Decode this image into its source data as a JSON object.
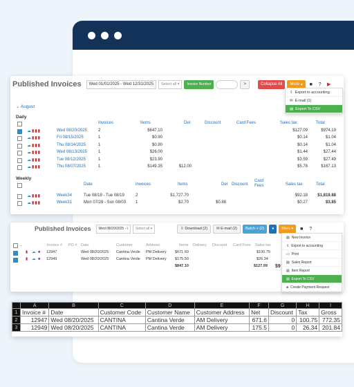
{
  "panel1": {
    "title": "Published Invoices",
    "date_range": "Wed 01/01/2025 - Wed 12/31/2025",
    "select_all": "Select all",
    "invoice_number_btn": "Invoice Number",
    "next_btn": ">",
    "collapse_all": "Collapse All",
    "more": "More",
    "dropdown": [
      "Export to accounting",
      "E-mail (1)",
      "Export To CSV"
    ],
    "month": "August",
    "daily_label": "Daily",
    "daily_headers": {
      "invoices": "Invoices",
      "items": "Items",
      "del": "Del",
      "discount": "Discount",
      "card_fees": "Card Fees",
      "sales_tax": "Sales tax",
      "total": "Total"
    },
    "daily_rows": [
      {
        "date": "Wed 08/20/2025",
        "invoices": "2",
        "items": "$647.10",
        "del": "",
        "sales_tax": "$127.09",
        "total": "$974.19",
        "checked": true
      },
      {
        "date": "Fri 08/15/2025",
        "invoices": "1",
        "items": "$0.90",
        "del": "",
        "sales_tax": "$0.14",
        "total": "$1.04",
        "checked": false
      },
      {
        "date": "Thu 08/14/2025",
        "invoices": "1",
        "items": "$0.90",
        "del": "",
        "sales_tax": "$0.14",
        "total": "$1.04",
        "checked": false
      },
      {
        "date": "Wed 08/13/2025",
        "invoices": "1",
        "items": "$26.00",
        "del": "",
        "sales_tax": "$1.44",
        "total": "$27.44",
        "checked": false
      },
      {
        "date": "Tue 08/12/2025",
        "invoices": "1",
        "items": "$23.90",
        "del": "",
        "sales_tax": "$3.59",
        "total": "$27.49",
        "checked": false
      },
      {
        "date": "Thu 08/07/2025",
        "invoices": "1",
        "items": "$149.35",
        "del": "$12.00",
        "sales_tax": "$5.78",
        "total": "$167.13",
        "checked": false
      }
    ],
    "weekly_label": "Weekly",
    "weekly_headers": {
      "date": "Date",
      "invoices": "Invoices",
      "items": "Items",
      "del": "Del",
      "discount": "Discount",
      "card_fees": "Card Fees",
      "sales_tax": "Sales tax",
      "total": "Total"
    },
    "weekly_rows": [
      {
        "week": "Week34",
        "date": "Tue 08/19 - Tue 08/19",
        "invoices": "2",
        "items": "$1,727.70",
        "del": "",
        "sales_tax": "$92.18",
        "total": "$1,819.88"
      },
      {
        "week": "Week31",
        "date": "Mon 07/28 - Sun 08/03",
        "invoices": "1",
        "items": "$2.70",
        "del": "$0.88",
        "sales_tax": "$0.27",
        "total": "$3.85"
      }
    ]
  },
  "panel2": {
    "title": "Published Invoices",
    "date": "Wed 08/20/2025 - \\",
    "select_all": "Select all",
    "download": "Download (2)",
    "email": "E-mail (2)",
    "batch": "Batch + (2)",
    "more": "More",
    "headers": [
      "Invoice #",
      "PO #",
      "Date",
      "Customer",
      "Address",
      "Items",
      "Delivery",
      "Discount",
      "Card Fees",
      "Sales tax"
    ],
    "rows": [
      {
        "invoice": "12947",
        "date": "Wed 08/20/2025",
        "customer": "Cantina Verde",
        "address": "PM Delivery",
        "items": "$671.60",
        "sales_tax": "$100.75"
      },
      {
        "invoice": "12949",
        "date": "Wed 08/20/2025",
        "customer": "Cantina Verde",
        "address": "PM Delivery",
        "items": "$175.50",
        "sales_tax": "$26.34"
      }
    ],
    "total_items": "$847.10",
    "total_tax": "$127.09",
    "total_extra": "$9",
    "dropdown": [
      "New Invoice",
      "Export to accounting",
      "Print",
      "Sales Report",
      "Item Report",
      "Export To CSV",
      "Create Payment Request"
    ]
  },
  "sheet": {
    "letters": [
      "A",
      "B",
      "C",
      "D",
      "E",
      "F",
      "G",
      "H",
      "I"
    ],
    "header": [
      "Invoice #",
      "Date",
      "Customer Code",
      "Customer Name",
      "Customer Address",
      "Net",
      "Discount",
      "Tax",
      "Gross"
    ],
    "rows": [
      [
        "12947",
        "Wed 08/20/2025",
        "CANTINA",
        "Cantina Verde",
        "AM Delivery",
        "671.6",
        "0",
        "100.75",
        "772.35"
      ],
      [
        "12949",
        "Wed 08/20/2025",
        "CANTINA",
        "Cantina Verde",
        "AM Delivery",
        "175.5",
        "0",
        "26.34",
        "201.84"
      ]
    ]
  }
}
